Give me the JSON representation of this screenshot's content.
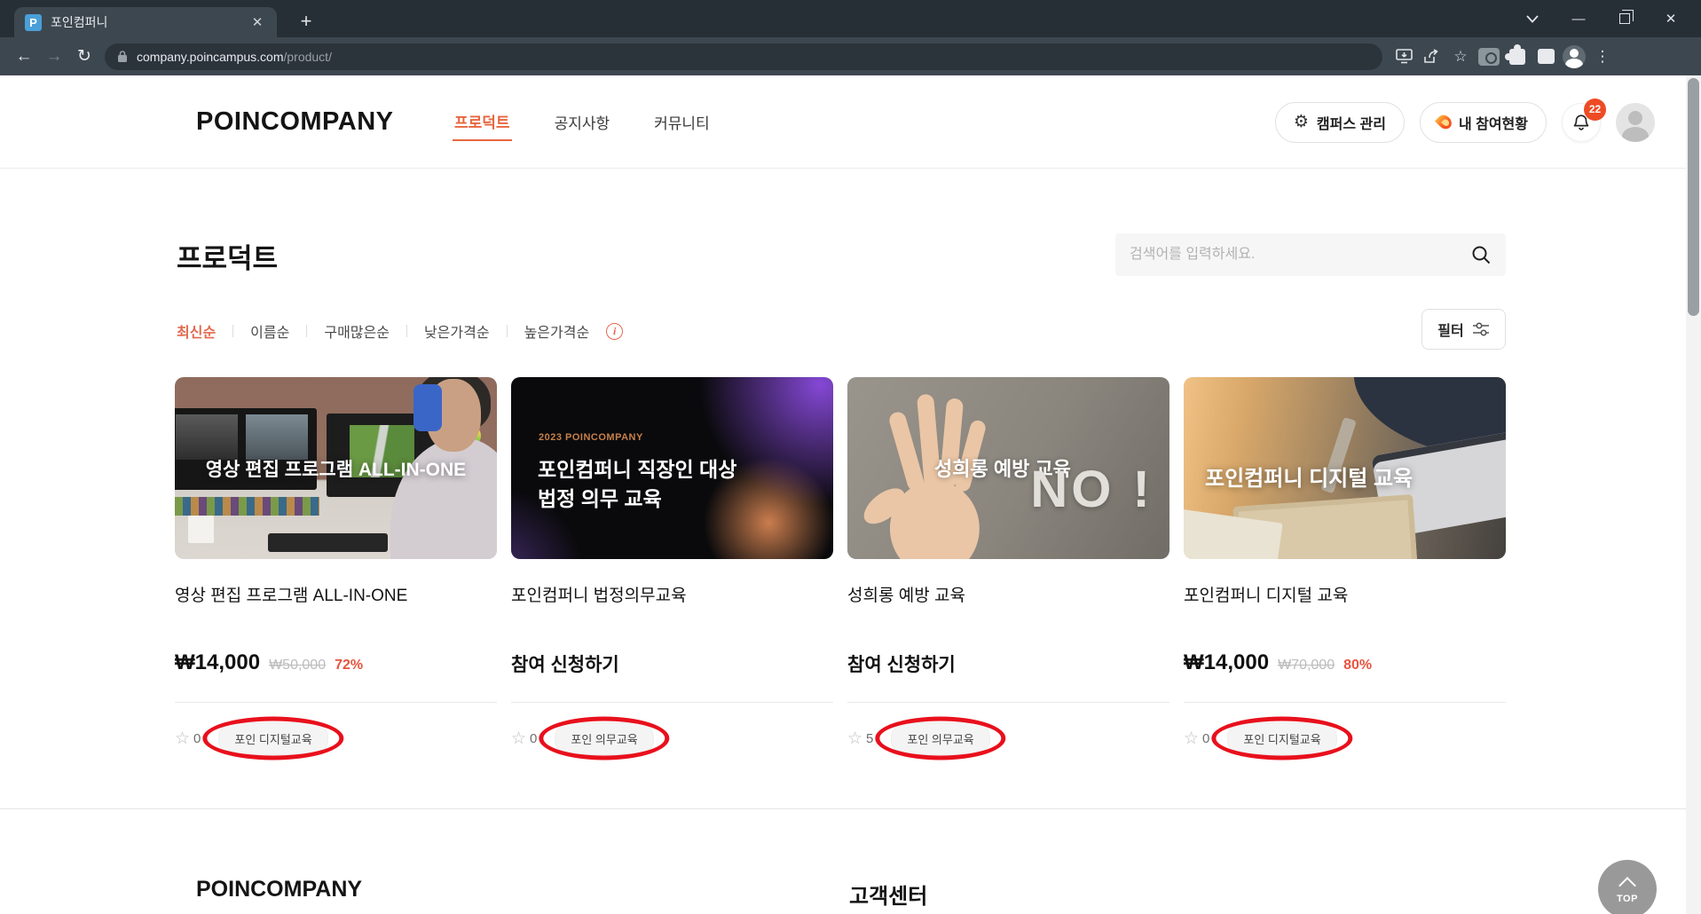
{
  "browser": {
    "tab": {
      "title": "포인컴퍼니",
      "favicon_letter": "P"
    },
    "url": {
      "host": "company.poincampus.com",
      "path": "/product/"
    }
  },
  "header": {
    "logo": "POINCOMPANY",
    "nav": [
      {
        "label": "프로덕트"
      },
      {
        "label": "공지사항"
      },
      {
        "label": "커뮤니티"
      }
    ],
    "campus_manage_label": "캠퍼스 관리",
    "participation_label": "내 참여현황",
    "notification_badge": "22"
  },
  "main": {
    "page_title": "프로덕트",
    "search_placeholder": "검색어를 입력하세요.",
    "sort": [
      {
        "label": "최신순"
      },
      {
        "label": "이름순"
      },
      {
        "label": "구매많은순"
      },
      {
        "label": "낮은가격순"
      },
      {
        "label": "높은가격순"
      }
    ],
    "filter_label": "필터",
    "products": [
      {
        "overlay": "영상 편집 프로그램 ALL-IN-ONE",
        "title": "영상 편집 프로그램 ALL-IN-ONE",
        "price": "₩14,000",
        "original_price": "₩50,000",
        "discount": "72%",
        "favorites": "0",
        "badge": "포인 디지털교육"
      },
      {
        "overlay_small": "2023 POINCOMPANY",
        "overlay_line1": "포인컴퍼니 직장인 대상",
        "overlay_line2": "법정 의무 교육",
        "title": "포인컴퍼니 법정의무교육",
        "cta": "참여 신청하기",
        "favorites": "0",
        "badge": "포인 의무교육"
      },
      {
        "overlay": "성희롱 예방 교육",
        "overlay_no": "NO !",
        "title": "성희롱 예방 교육",
        "cta": "참여 신청하기",
        "favorites": "5",
        "badge": "포인 의무교육"
      },
      {
        "overlay": "포인컴퍼니 디지털 교육",
        "title": "포인컴퍼니 디지털 교육",
        "price": "₩14,000",
        "original_price": "₩70,000",
        "discount": "80%",
        "favorites": "0",
        "badge": "포인 디지털교육"
      }
    ]
  },
  "footer": {
    "company": "POINCOMPANY",
    "customer_center": "고객센터"
  },
  "floating": {
    "top_button": "TOP"
  },
  "colors": {
    "accent": "#e8663f",
    "discount": "#e65540",
    "annotation_red": "#e8101c",
    "badge_red": "#ee4b25"
  }
}
